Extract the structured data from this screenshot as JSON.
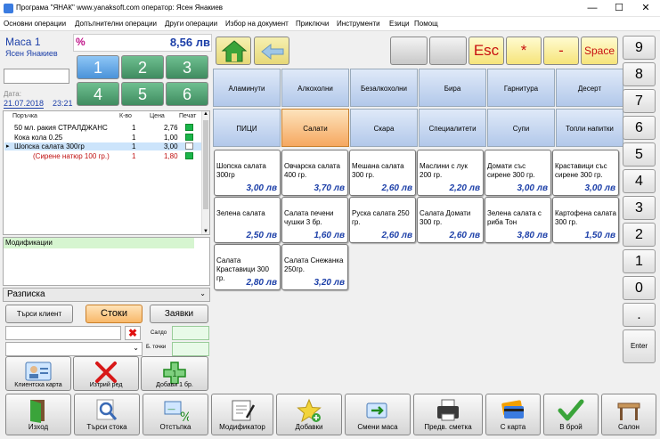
{
  "window": {
    "title": "Програма \"ЯНАК\"    www.yanaksoft.com    оператор: Ясен Янакиев",
    "minimize": "—",
    "maximize": "☐",
    "close": "✕"
  },
  "menu": [
    "Основни операции",
    "Допълнителни операции",
    "Други операции",
    "Избор на документ",
    "Приключи",
    "Инструменти",
    "Езици",
    "Помощ"
  ],
  "table": {
    "name": "Маса 1",
    "operator": "Ясен Янакиев",
    "percent_sign": "%",
    "total": "8,56 лв"
  },
  "date": {
    "label": "Дата:",
    "date": "21.07.2018",
    "time": "23:21"
  },
  "table_pad": [
    "1",
    "2",
    "3",
    "4",
    "5",
    "6"
  ],
  "order": {
    "headers": {
      "item": "Поръчка",
      "qty": "К-во",
      "price": "Цена",
      "print": "Печат"
    },
    "rows": [
      {
        "name": "50 мл. ракия СТРАЛДЖАНС",
        "qty": "1",
        "price": "2,76",
        "printed": true
      },
      {
        "name": "Кока кола 0.25",
        "qty": "1",
        "price": "1,00",
        "printed": true
      },
      {
        "name": "Шопска салата 300гр",
        "qty": "1",
        "price": "3,00",
        "printed": false
      },
      {
        "name": "(Сирене натюр 100 гр.)",
        "qty": "1",
        "price": "1,80",
        "printed": true
      }
    ]
  },
  "modifications": {
    "label": "Модификации"
  },
  "receipt": {
    "label": "Разписка"
  },
  "client_buttons": {
    "find_client": "Търси клиент",
    "goods": "Стоки",
    "requests": "Заявки"
  },
  "client_fields": {
    "saldo": "Салдо",
    "points": "Б. точки"
  },
  "left_buttons": {
    "client_card": "Клиентска карта",
    "delete_row": "Изтрий ред",
    "add_one": "Добави 1 бр."
  },
  "top_buttons": {
    "esc": "Esc",
    "star": "*",
    "minus": "-",
    "space": "Space"
  },
  "categories": [
    "Аламинути",
    "Алкохолни",
    "Безалкохолни",
    "Бира",
    "Гарнитура",
    "Десерт",
    "ПИЦИ",
    "Салати",
    "Скара",
    "Специалитети",
    "Супи",
    "Топли напитки"
  ],
  "selected_category": "Салати",
  "products": [
    {
      "name": "Шопска салата 300гр",
      "price": "3,00 лв"
    },
    {
      "name": "Овчарска салата 400 гр.",
      "price": "3,70 лв"
    },
    {
      "name": "Мешана салата 300 гр.",
      "price": "2,60 лв"
    },
    {
      "name": "Маслини с лук 200 гр.",
      "price": "2,20 лв"
    },
    {
      "name": "Домати със сирене 300 гр.",
      "price": "3,00 лв"
    },
    {
      "name": "Краставици със сирене 300 гр.",
      "price": "3,00 лв"
    },
    {
      "name": "Зелена салата",
      "price": "2,50 лв"
    },
    {
      "name": "Салата печени чушки 3 бр.",
      "price": "1,60 лв"
    },
    {
      "name": "Руска салата 250 гр.",
      "price": "2,60 лв"
    },
    {
      "name": "Салата Домати 300 гр.",
      "price": "2,60 лв"
    },
    {
      "name": "Зелена салата с риба Тон",
      "price": "3,80 лв"
    },
    {
      "name": "Картофена салата 300 гр.",
      "price": "1,50 лв"
    },
    {
      "name": "Салата Краставици 300 гр.",
      "price": "2,80 лв"
    },
    {
      "name": "Салата Снежанка 250гр.",
      "price": "3,20 лв"
    }
  ],
  "keypad": [
    "9",
    "8",
    "7",
    "6",
    "5",
    "4",
    "3",
    "2",
    "1",
    "0",
    ".",
    "Enter"
  ],
  "toolbar": [
    {
      "label": "Изход",
      "icon": "exit-door-icon"
    },
    {
      "label": "Търси стока",
      "icon": "magnifier-icon"
    },
    {
      "label": "Отстъпка",
      "icon": "discount-icon"
    },
    {
      "label": "Модификатор",
      "icon": "modifier-notepad-icon"
    },
    {
      "label": "Добавки",
      "icon": "star-icon"
    },
    {
      "label": "Смени маса",
      "icon": "change-table-icon"
    },
    {
      "label": "Предв. сметка",
      "icon": "printer-icon"
    },
    {
      "label": "С карта",
      "icon": "credit-card-icon"
    },
    {
      "label": "В брой",
      "icon": "checkmark-icon"
    },
    {
      "label": "Салон",
      "icon": "table-icon"
    }
  ],
  "colors": {
    "accent": "#1c3fa8",
    "total_pink": "#c0158a",
    "selected_category": "#f6a860"
  }
}
